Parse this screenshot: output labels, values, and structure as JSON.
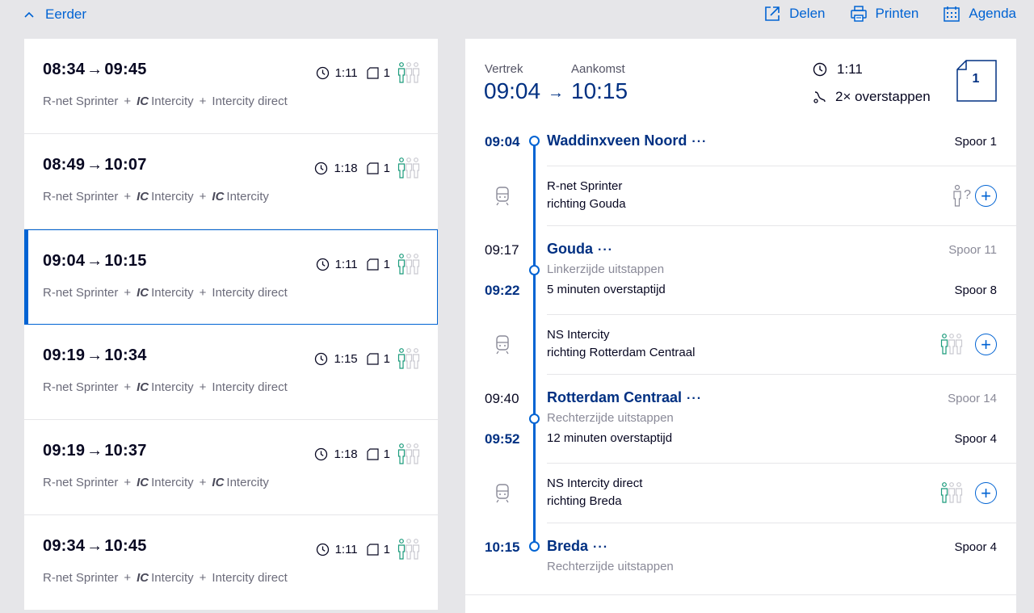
{
  "top": {
    "earlier_label": "Eerder",
    "share_label": "Delen",
    "print_label": "Printen",
    "agenda_label": "Agenda"
  },
  "trips": [
    {
      "depart": "08:34",
      "arrive": "09:45",
      "duration": "1:11",
      "transfers": "1",
      "modes": [
        {
          "ic": false,
          "text": "R-net Sprinter"
        },
        {
          "ic": true,
          "text": "Intercity"
        },
        {
          "ic": false,
          "text": "Intercity direct"
        }
      ]
    },
    {
      "depart": "08:49",
      "arrive": "10:07",
      "duration": "1:18",
      "transfers": "1",
      "modes": [
        {
          "ic": false,
          "text": "R-net Sprinter"
        },
        {
          "ic": true,
          "text": "Intercity"
        },
        {
          "ic": true,
          "text": "Intercity"
        }
      ]
    },
    {
      "depart": "09:04",
      "arrive": "10:15",
      "duration": "1:11",
      "transfers": "1",
      "selected": true,
      "modes": [
        {
          "ic": false,
          "text": "R-net Sprinter"
        },
        {
          "ic": true,
          "text": "Intercity"
        },
        {
          "ic": false,
          "text": "Intercity direct"
        }
      ]
    },
    {
      "depart": "09:19",
      "arrive": "10:34",
      "duration": "1:15",
      "transfers": "1",
      "modes": [
        {
          "ic": false,
          "text": "R-net Sprinter"
        },
        {
          "ic": true,
          "text": "Intercity"
        },
        {
          "ic": false,
          "text": "Intercity direct"
        }
      ]
    },
    {
      "depart": "09:19",
      "arrive": "10:37",
      "duration": "1:18",
      "transfers": "1",
      "modes": [
        {
          "ic": false,
          "text": "R-net Sprinter"
        },
        {
          "ic": true,
          "text": "Intercity"
        },
        {
          "ic": true,
          "text": "Intercity"
        }
      ]
    },
    {
      "depart": "09:34",
      "arrive": "10:45",
      "duration": "1:11",
      "transfers": "1",
      "modes": [
        {
          "ic": false,
          "text": "R-net Sprinter"
        },
        {
          "ic": true,
          "text": "Intercity"
        },
        {
          "ic": false,
          "text": "Intercity direct"
        }
      ]
    }
  ],
  "ic_abbr": "IC",
  "arrow": "→",
  "plus_sign": "+",
  "detail": {
    "depart_label": "Vertrek",
    "arrive_label": "Aankomst",
    "depart_time": "09:04",
    "arrive_time": "10:15",
    "duration": "1:11",
    "transfers_text": "2× overstappen",
    "class": "1",
    "more": "···",
    "stops": {
      "waddinxveen": {
        "time": "09:04",
        "name": "Waddinxveen Noord",
        "track": "Spoor 1"
      },
      "gouda": {
        "arr_time": "09:17",
        "dep_time": "09:22",
        "name": "Gouda",
        "side": "Linkerzijde uitstappen",
        "transfer": "5 minuten overstaptijd",
        "arr_track": "Spoor 11",
        "dep_track": "Spoor 8"
      },
      "rotterdam": {
        "arr_time": "09:40",
        "dep_time": "09:52",
        "name": "Rotterdam Centraal",
        "side": "Rechterzijde uitstappen",
        "transfer": "12 minuten overstaptijd",
        "arr_track": "Spoor 14",
        "dep_track": "Spoor 4"
      },
      "breda": {
        "time": "10:15",
        "name": "Breda",
        "side": "Rechterzijde uitstappen",
        "track": "Spoor 4"
      }
    },
    "legs": [
      {
        "train": "R-net Sprinter",
        "direction": "richting Gouda",
        "crowd_unknown": "?"
      },
      {
        "train": "NS Intercity",
        "direction": "richting Rotterdam Centraal"
      },
      {
        "train": "NS Intercity direct",
        "direction": "richting Breda"
      }
    ],
    "add_label": "+"
  },
  "colors": {
    "accent": "#0063d3",
    "navy": "#003082",
    "crowd_green": "#1a9b7b",
    "background": "#e6e6e9"
  }
}
